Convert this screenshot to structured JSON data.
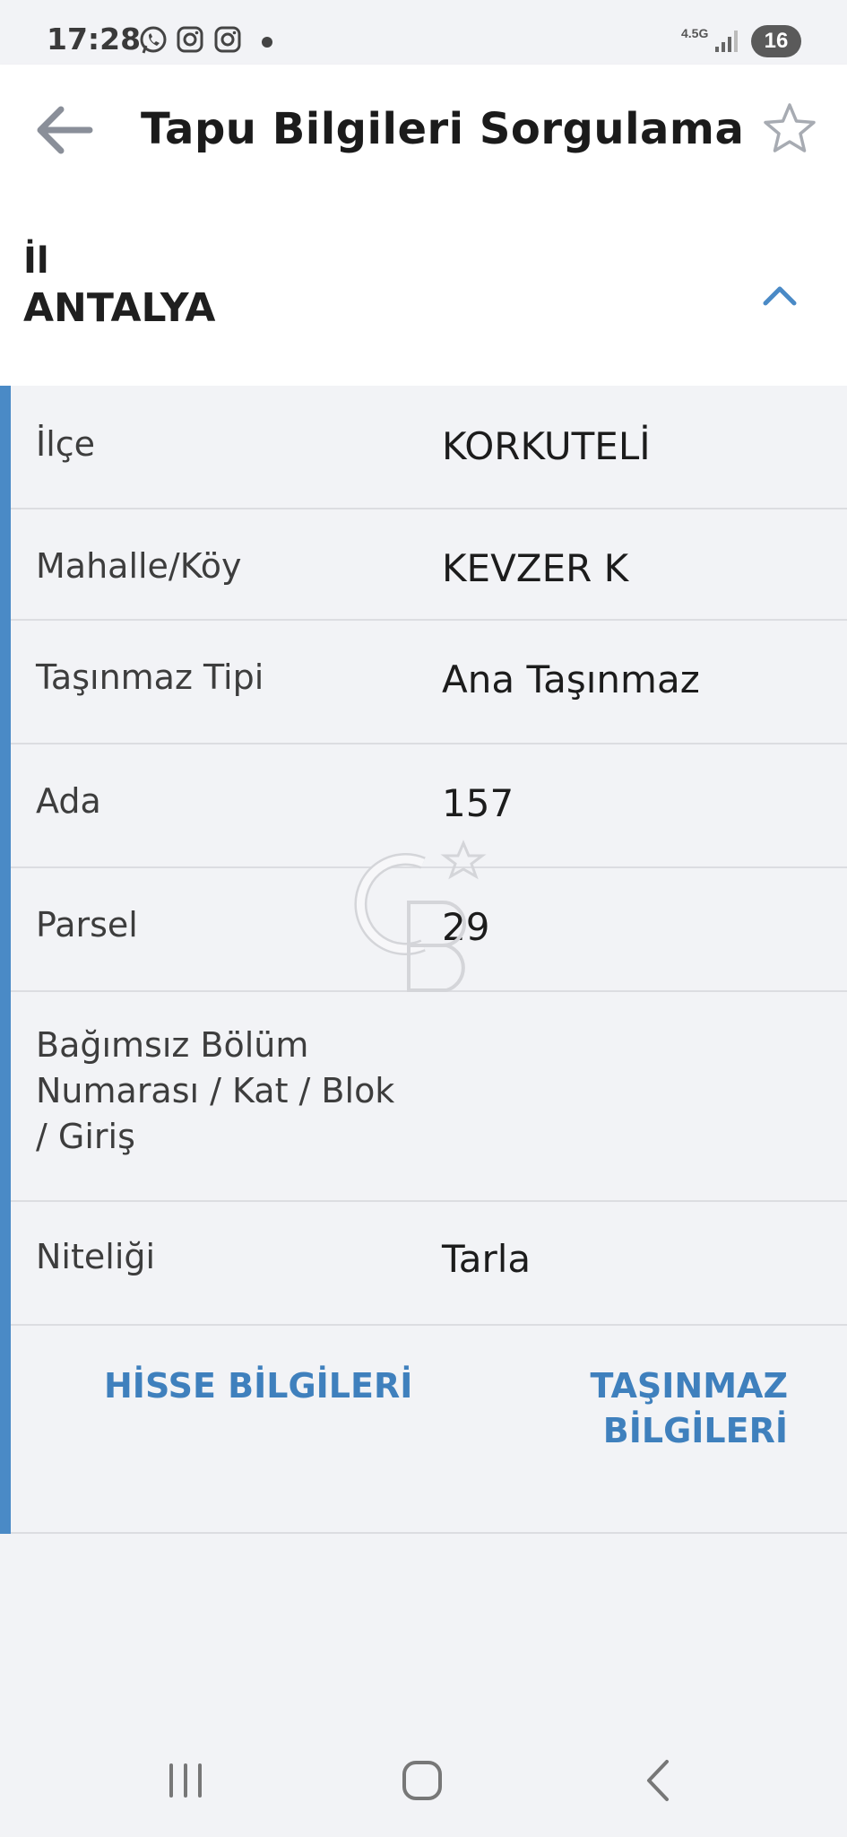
{
  "status_bar": {
    "time": "17:28",
    "notification_icons": [
      "whatsapp-icon",
      "instagram-icon",
      "instagram-icon"
    ],
    "network_label": "4.5G",
    "battery_level": "16"
  },
  "header": {
    "title": "Tapu Bilgileri Sorgulama",
    "back_icon": "arrow-left-icon",
    "favorite_icon": "star-outline-icon"
  },
  "province": {
    "label": "İl",
    "value": "ANTALYA",
    "expanded": true
  },
  "details": {
    "rows": [
      {
        "label": "İlçe",
        "value": "KORKUTELİ"
      },
      {
        "label": "Mahalle/Köy",
        "value": "KEVZER K"
      },
      {
        "label": "Taşınmaz Tipi",
        "value": "Ana Taşınmaz"
      },
      {
        "label": "Ada",
        "value": "157"
      },
      {
        "label": "Parsel",
        "value": "29"
      },
      {
        "label_lines": [
          "Bağımsız Bölüm",
          "Numarası / Kat / Blok",
          "/ Giriş"
        ],
        "value": ""
      },
      {
        "label": "Niteliği",
        "value": "Tarla"
      }
    ],
    "actions": {
      "share_info": "HİSSE BİLGİLERİ",
      "property_info_lines": [
        "TAŞINMAZ",
        "BİLGİLERİ"
      ]
    }
  },
  "colors": {
    "accent": "#4a8ac6",
    "action_text": "#3f80bd",
    "background": "#f2f3f6"
  }
}
